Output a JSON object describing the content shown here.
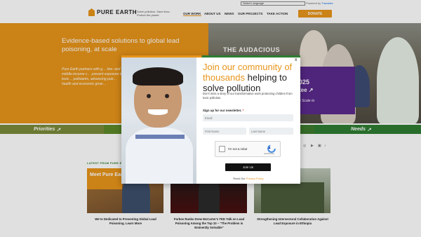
{
  "language_select": {
    "value": "Select Language"
  },
  "translate": {
    "powered": "Powered by",
    "brand": "Translate"
  },
  "header": {
    "logo_text": "PURE EARTH",
    "tagline": "Solve pollution. Save lives. Protect the planet.",
    "nav": [
      "OUR WORK",
      "ABOUT US",
      "NEWS",
      "OUR PROJECTS",
      "TAKE ACTION"
    ],
    "donate_label": "DONATE",
    "colors": {
      "accent": "#e8941a",
      "green": "#2e7d32",
      "purple": "#5a2a8c"
    }
  },
  "hero": {
    "heading": "Evidence-based solutions to global lead poisoning, at scale",
    "body": "Pure Earth partners with g… low- and middle-income c… prevent exposure to toxic… pollutants, advancing pub… health and economic grow…",
    "audacious_label": "THE AUDACIOUS",
    "promo_line1": "025",
    "promo_line2": "tee",
    "promo_line3": "e Scale to"
  },
  "bar": {
    "priorities": "Priorities",
    "needs": "Needs"
  },
  "latest_label": "LATEST FROM PURE EARTH",
  "cards": [
    {
      "overlay": "Meet Pure Earth",
      "caption": "We're Dedicated to Preventing Global Lead Poisoning. Learn More"
    },
    {
      "caption": "Forbes Ranks Drew McCarter's TED Talk on Lead Poisoning Among the Top 10 – \"The Problem is Eminently Solvable\""
    },
    {
      "caption": "Strengthening Intersectoral Collaboration Against Lead Exposure in Ethiopia"
    }
  ],
  "modal": {
    "close": "x",
    "heading_orange": "Join our community of thousands",
    "heading_dark": "helping to solve pollution",
    "body": "Don't miss a story of our transformative work protecting children from toxic pollution.",
    "signup_label": "Sign up for our newsletter.",
    "required_mark": "*",
    "email_placeholder": "Email",
    "first_name_placeholder": "First Name",
    "last_name_placeholder": "Last Name",
    "recaptcha_label": "I'm not a robot",
    "recaptcha_brand": "reCAPTCHA",
    "join_label": "Join Us",
    "read_prefix": "Read Our",
    "privacy_link": "Privacy Policy"
  }
}
